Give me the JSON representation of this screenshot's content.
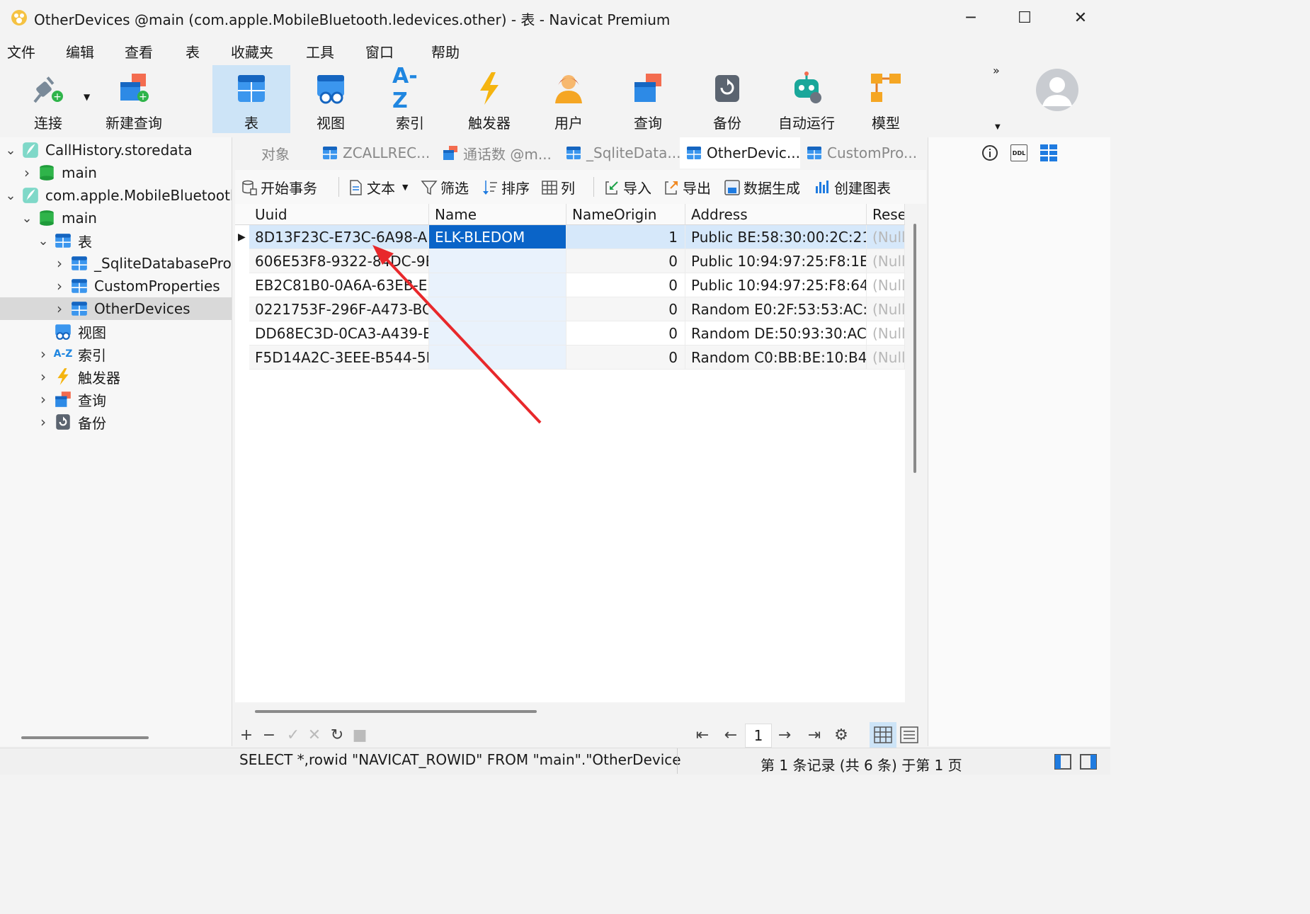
{
  "window": {
    "title": "OtherDevices @main (com.apple.MobileBluetooth.ledevices.other) - 表 - Navicat Premium",
    "minimize_glyph": "─",
    "maximize_glyph": "☐",
    "close_glyph": "✕"
  },
  "menu": [
    "文件",
    "编辑",
    "查看",
    "表",
    "收藏夹",
    "工具",
    "窗口",
    "帮助"
  ],
  "toolbar": {
    "buttons": [
      {
        "label": "连接",
        "icon": "connection-plug-icon"
      },
      {
        "label": "新建查询",
        "icon": "new-query-icon"
      },
      {
        "label": "表",
        "icon": "table-icon",
        "active": true
      },
      {
        "label": "视图",
        "icon": "view-icon"
      },
      {
        "label": "索引",
        "icon": "index-az-icon",
        "glyph": "A-Z"
      },
      {
        "label": "触发器",
        "icon": "trigger-bolt-icon"
      },
      {
        "label": "用户",
        "icon": "user-icon"
      },
      {
        "label": "查询",
        "icon": "query-icon"
      },
      {
        "label": "备份",
        "icon": "backup-icon"
      },
      {
        "label": "自动运行",
        "icon": "robot-icon"
      },
      {
        "label": "模型",
        "icon": "model-icon"
      }
    ],
    "overflow_glyph": "»"
  },
  "sidebar": {
    "tree": [
      {
        "label": "CallHistory.storedata",
        "icon": "sqlite-feather-icon",
        "expanded": true
      },
      {
        "label": "main",
        "icon": "database-icon",
        "expanded": false
      },
      {
        "label": "com.apple.MobileBluetooth",
        "icon": "sqlite-feather-icon",
        "expanded": true
      },
      {
        "label": "main",
        "icon": "database-icon",
        "expanded": true
      },
      {
        "label": "表",
        "icon": "table-icon",
        "expanded": true
      },
      {
        "label": "_SqliteDatabaseProp",
        "icon": "table-icon",
        "expanded": false
      },
      {
        "label": "CustomProperties",
        "icon": "table-icon",
        "expanded": false
      },
      {
        "label": "OtherDevices",
        "icon": "table-icon",
        "expanded": false,
        "selected": true
      },
      {
        "label": "视图",
        "icon": "view-icon"
      },
      {
        "label": "索引",
        "icon": "index-az-icon",
        "glyph": "A-Z",
        "expanded": false
      },
      {
        "label": "触发器",
        "icon": "trigger-bolt-icon",
        "expanded": false
      },
      {
        "label": "查询",
        "icon": "query-icon",
        "expanded": false
      },
      {
        "label": "备份",
        "icon": "backup-icon",
        "expanded": false
      }
    ]
  },
  "tabs": [
    {
      "label": "对象",
      "active": false
    },
    {
      "label": "ZCALLREC...",
      "active": false
    },
    {
      "label": "通话数 @m...",
      "active": false
    },
    {
      "label": "_SqliteData...",
      "active": false
    },
    {
      "label": "OtherDevic...",
      "active": true
    },
    {
      "label": "CustomPro...",
      "active": false
    }
  ],
  "right_panel": {
    "icons": [
      "info-icon",
      "ddl-icon",
      "grid-view-icon"
    ],
    "ddl_label": "DDL"
  },
  "data_toolbar": [
    {
      "label": "开始事务",
      "icon": "transaction-icon"
    },
    {
      "label": "文本",
      "icon": "text-doc-icon",
      "dropdown": true
    },
    {
      "label": "筛选",
      "icon": "filter-icon"
    },
    {
      "label": "排序",
      "icon": "sort-icon"
    },
    {
      "label": "列",
      "icon": "columns-icon"
    },
    {
      "label": "导入",
      "icon": "import-icon"
    },
    {
      "label": "导出",
      "icon": "export-icon"
    },
    {
      "label": "数据生成",
      "icon": "data-generate-icon"
    },
    {
      "label": "创建图表",
      "icon": "chart-icon"
    }
  ],
  "grid": {
    "columns": [
      "Uuid",
      "Name",
      "NameOrigin",
      "Address",
      "Rese"
    ],
    "rows": [
      [
        "8D13F23C-E73C-6A98-A",
        "ELK-BLEDOM",
        "1",
        "Public BE:58:30:00:2C:21",
        "(Null"
      ],
      [
        "606E53F8-9322-84DC-9B",
        "",
        "0",
        "Public 10:94:97:25:F8:1E",
        "(Null"
      ],
      [
        "EB2C81B0-0A6A-63EB-E5",
        "",
        "0",
        "Public 10:94:97:25:F8:64",
        "(Null"
      ],
      [
        "0221753F-296F-A473-BC",
        "",
        "0",
        "Random E0:2F:53:53:AC:E",
        "(Null"
      ],
      [
        "DD68EC3D-0CA3-A439-E",
        "",
        "0",
        "Random DE:50:93:30:AC:",
        "(Null"
      ],
      [
        "F5D14A2C-3EEE-B544-5F",
        "",
        "0",
        "Random C0:BB:BE:10:B4:I",
        "(Null"
      ]
    ],
    "current_row_marker": "▶"
  },
  "bottom": {
    "edit_buttons": [
      {
        "glyph": "+",
        "icon": "add-record-icon"
      },
      {
        "glyph": "−",
        "icon": "delete-record-icon"
      },
      {
        "glyph": "✓",
        "icon": "apply-icon"
      },
      {
        "glyph": "✕",
        "icon": "discard-icon"
      },
      {
        "glyph": "↻",
        "icon": "refresh-icon"
      },
      {
        "glyph": "■",
        "icon": "stop-icon"
      }
    ],
    "nav": {
      "first": "⇤",
      "prev": "←",
      "page": "1",
      "next": "→",
      "last": "⇥",
      "settings": "⚙"
    }
  },
  "status": {
    "sql": "SELECT *,rowid \"NAVICAT_ROWID\" FROM \"main\".\"OtherDevice",
    "page_info": "第 1 条记录 (共 6 条) 于第 1 页"
  },
  "colors": {
    "accent": "#0a64c8",
    "annotation_arrow": "#e8282b"
  }
}
